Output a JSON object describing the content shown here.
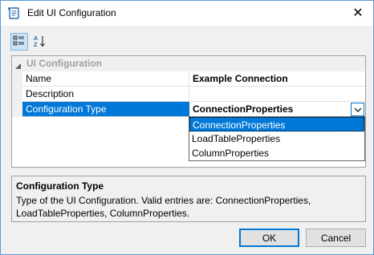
{
  "window": {
    "title": "Edit UI Configuration",
    "close_glyph": "✕"
  },
  "toolbar": {
    "categorized_icon": "categorized-view-icon",
    "alphabetical_icon": "sort-alphabetical-icon"
  },
  "grid": {
    "category": "UI Configuration",
    "rows": [
      {
        "name": "Name",
        "value": "Example Connection"
      },
      {
        "name": "Description",
        "value": ""
      },
      {
        "name": "Configuration Type",
        "value": "ConnectionProperties"
      }
    ]
  },
  "dropdown": {
    "options": [
      "ConnectionProperties",
      "LoadTableProperties",
      "ColumnProperties"
    ],
    "selected": "ConnectionProperties"
  },
  "help": {
    "title": "Configuration Type",
    "text": "Type of the UI Configuration. Valid entries are: ConnectionProperties, LoadTableProperties, ColumnProperties."
  },
  "buttons": {
    "ok": "OK",
    "cancel": "Cancel"
  },
  "colors": {
    "accent": "#0078d7",
    "border": "#a0a0a0",
    "background": "#f0f0f0"
  }
}
